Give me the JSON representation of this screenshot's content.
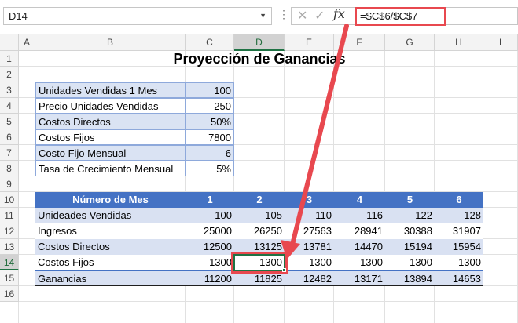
{
  "formula_bar": {
    "name_box": "D14",
    "formula": "=$C$6/$C$7",
    "fx_label": "fx",
    "cancel_icon": "close-icon",
    "enter_icon": "checkmark-icon"
  },
  "columns": [
    "A",
    "B",
    "C",
    "D",
    "E",
    "F",
    "G",
    "H",
    "I"
  ],
  "rows": [
    "1",
    "2",
    "3",
    "4",
    "5",
    "6",
    "7",
    "8",
    "9",
    "10",
    "11",
    "12",
    "13",
    "14",
    "15",
    "16"
  ],
  "title": "Proyección de Ganancias",
  "inputs": [
    {
      "label": "Unidades Vendidas 1 Mes",
      "value": "100"
    },
    {
      "label": "Precio Unidades Vendidas",
      "value": "250"
    },
    {
      "label": "Costos Directos",
      "value": "50%"
    },
    {
      "label": "Costos Fijos",
      "value": "7800"
    },
    {
      "label": "Costo Fijo Mensual",
      "value": "6"
    },
    {
      "label": "Tasa de Crecimiento Mensual",
      "value": "5%"
    }
  ],
  "table": {
    "header_label": "Número de Mes",
    "months": [
      "1",
      "2",
      "3",
      "4",
      "5",
      "6"
    ],
    "rows": [
      {
        "label": "Unideades Vendidas",
        "values": [
          "100",
          "105",
          "110",
          "116",
          "122",
          "128"
        ]
      },
      {
        "label": "Ingresos",
        "values": [
          "25000",
          "26250",
          "27563",
          "28941",
          "30388",
          "31907"
        ]
      },
      {
        "label": "Costos Directos",
        "values": [
          "12500",
          "13125",
          "13781",
          "14470",
          "15194",
          "15954"
        ]
      },
      {
        "label": "Costos Fijos",
        "values": [
          "1300",
          "1300",
          "1300",
          "1300",
          "1300",
          "1300"
        ]
      },
      {
        "label": "Ganancias",
        "values": [
          "11200",
          "11825",
          "12482",
          "13171",
          "13894",
          "14653"
        ]
      }
    ]
  },
  "colors": {
    "accent": "#4472c4",
    "band": "#d9e1f2",
    "highlight": "#e8484f",
    "selection": "#1f7244"
  }
}
